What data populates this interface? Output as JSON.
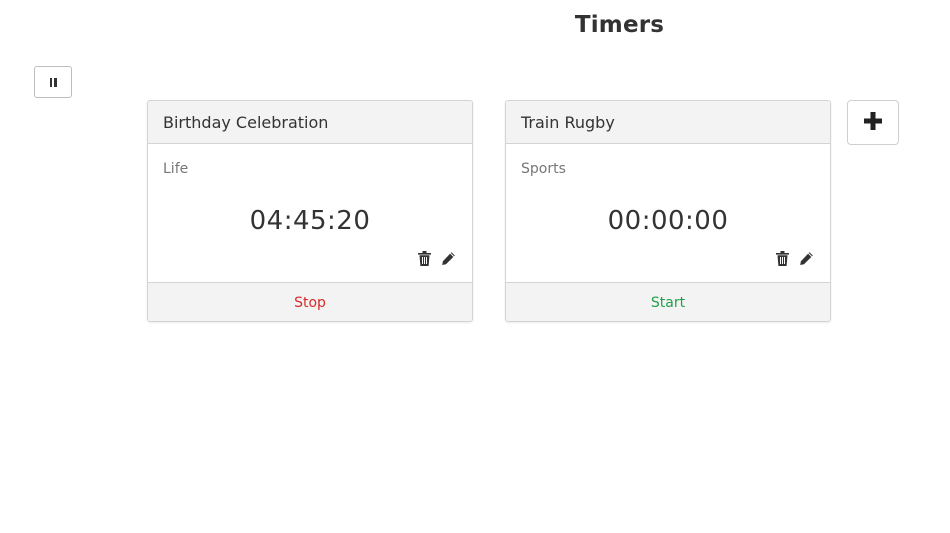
{
  "page": {
    "title": "Timers"
  },
  "toolbar": {
    "pause_icon": "pause-icon"
  },
  "timers": [
    {
      "title": "Birthday Celebration",
      "project": "Life",
      "elapsed": "04:45:20",
      "action_label": "Stop",
      "action_color": "#db2828",
      "running": true
    },
    {
      "title": "Train Rugby",
      "project": "Sports",
      "elapsed": "00:00:00",
      "action_label": "Start",
      "action_color": "#21a04a",
      "running": false
    }
  ],
  "icons": {
    "delete": "trash-icon",
    "edit": "pencil-icon",
    "add": "plus-icon"
  }
}
